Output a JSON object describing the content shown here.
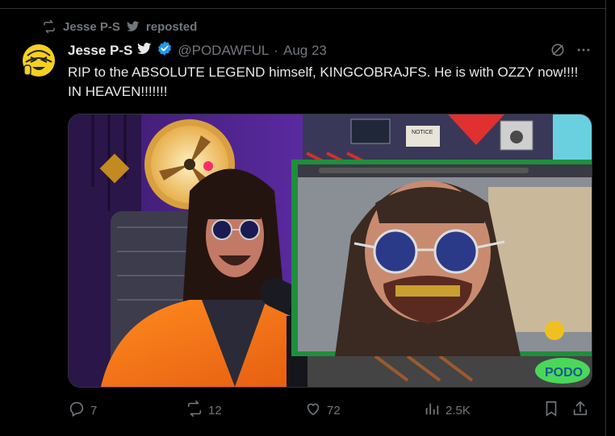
{
  "repost": {
    "reposter": "Jesse P-S",
    "label": "reposted"
  },
  "author": {
    "name": "Jesse P-S",
    "handle": "@PODAWFUL",
    "date": "Aug 23",
    "date_sep": "·"
  },
  "tweet": {
    "text": "RIP to the ABSOLUTE LEGEND himself, KINGCOBRAJFS. He is with OZZY now!!!! IN HEAVEN!!!!!!!"
  },
  "media": {
    "sign_text": "NOTICE",
    "screen_label": ""
  },
  "actions": {
    "replies": "7",
    "reposts": "12",
    "likes": "72",
    "views": "2.5K"
  },
  "colors": {
    "verified": "#1d9bf0",
    "text": "#e7e9ea",
    "muted": "#71767b",
    "background": "#000000",
    "green_frame": "#1e8f3a"
  },
  "icons": [
    "repost-icon",
    "bird-icon",
    "verified-badge-icon",
    "grok-icon",
    "more-icon",
    "reply-icon",
    "like-icon",
    "views-icon",
    "bookmark-icon",
    "share-icon"
  ]
}
